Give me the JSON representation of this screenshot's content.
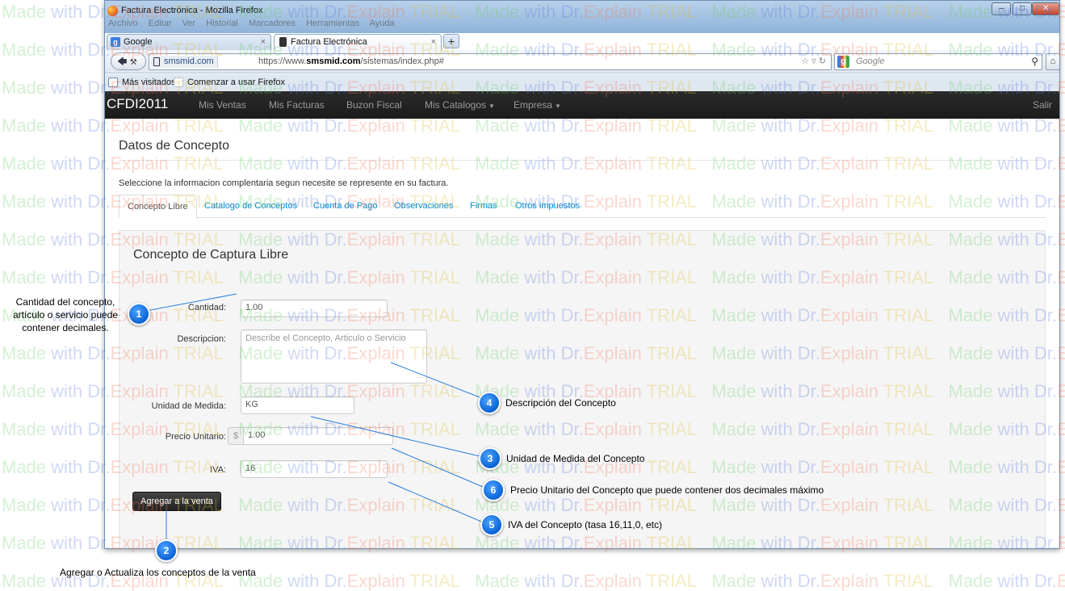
{
  "browser": {
    "window_title": "Factura Electrónica - Mozilla Firefox",
    "menu_items": [
      "Archivo",
      "Editar",
      "Ver",
      "Historial",
      "Marcadores",
      "Herramientas",
      "Ayuda"
    ],
    "tabs": [
      {
        "label": "Google",
        "icon": "google-favicon"
      },
      {
        "label": "Factura Electrónica",
        "icon": "page-favicon"
      }
    ],
    "new_tab_label": "+",
    "site_identity": "smsmid.com",
    "url_prefix": "https://www.",
    "url_domain": "smsmid.com",
    "url_path": "/sistemas/index.php#",
    "search_placeholder": "Google",
    "bookmarks": [
      "Más visitados",
      "Comenzar a usar Firefox"
    ]
  },
  "app_nav": {
    "brand": "CFDI2011",
    "links": [
      "Mis Ventas",
      "Mis Facturas",
      "Buzon Fiscal",
      "Mis Catalogos",
      "Empresa"
    ],
    "salir": "Salir"
  },
  "page": {
    "title": "Datos de Concepto",
    "description": "Seleccione la informacion complentaria segun necesite se represente en su factura.",
    "tabs": [
      "Concepto Libre",
      "Catalogo de Conceptos",
      "Cuenta de Pago",
      "Observaciones",
      "Firmas",
      "Otros impuestos"
    ],
    "active_tab": "Concepto Libre"
  },
  "form": {
    "legend": "Concepto de Captura Libre",
    "cantidad_label": "Cantidad:",
    "cantidad_value": "1.00",
    "descripcion_label": "Descripcion:",
    "descripcion_placeholder": "Describe el Concepto, Articulo o Servicio",
    "unidad_label": "Unidad de Medida:",
    "unidad_value": "KG",
    "precio_label": "Precio Unitario:",
    "precio_prefix": "$",
    "precio_value": "1.00",
    "iva_label": "IVA:",
    "iva_value": "16",
    "submit_label": "Agregar a la venta"
  },
  "annotations": [
    {
      "n": "1",
      "text": "Cantidad del concepto, artículo o servicio puede contener decimales."
    },
    {
      "n": "2",
      "text": "Agregar o Actualiza los conceptos de la venta"
    },
    {
      "n": "3",
      "text": "Unidad de Medida del Concepto"
    },
    {
      "n": "4",
      "text": "Descripción del Concepto"
    },
    {
      "n": "5",
      "text": "IVA del Concepto (tasa 16,11,0, etc)"
    },
    {
      "n": "6",
      "text": "Precio Unitario del Concepto que puede contener dos decimales máximo"
    }
  ],
  "watermark": {
    "made": "Made",
    "with": "with",
    "brand": "Dr.Explain",
    "trial": "TRIAL"
  },
  "colors": {
    "marker": "#0b63d6",
    "link": "#0088cc",
    "navbar": "#1b1b1b"
  }
}
